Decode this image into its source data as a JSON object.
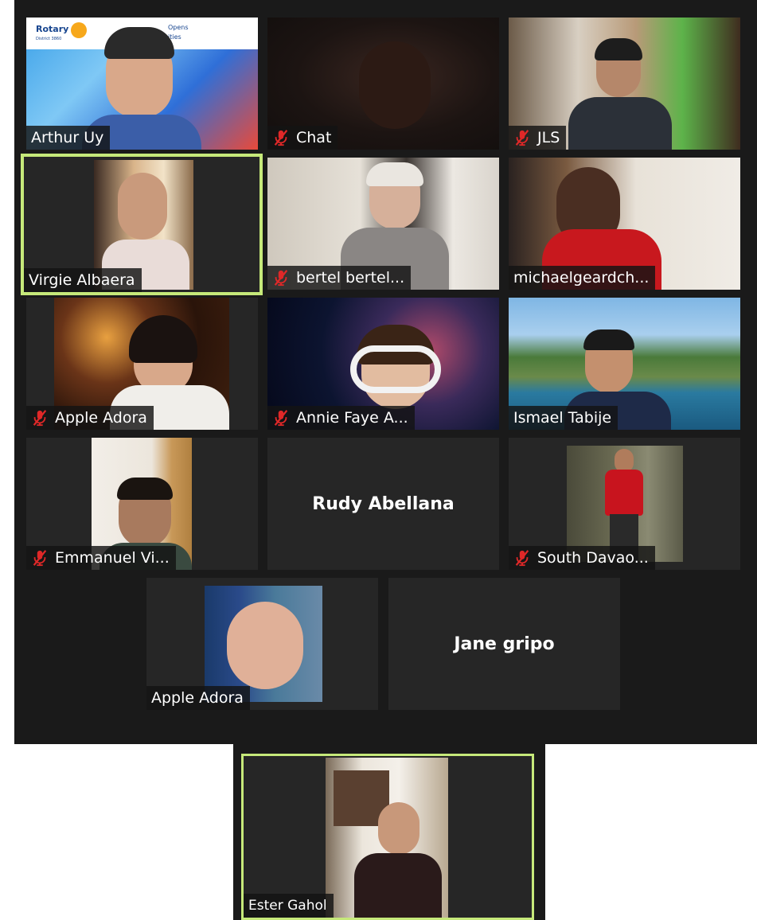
{
  "participants": [
    {
      "name": "Arthur Uy",
      "muted": false
    },
    {
      "name": "Chat",
      "muted": true
    },
    {
      "name": "JLS",
      "muted": true
    },
    {
      "name": "Virgie Albaera",
      "muted": false,
      "speaking": true
    },
    {
      "name": "bertel bertel...",
      "muted": true
    },
    {
      "name": "michaelgeardch...",
      "muted": false
    },
    {
      "name": "Apple Adora",
      "muted": true
    },
    {
      "name": "Annie Faye A...",
      "muted": true
    },
    {
      "name": "Ismael Tabije",
      "muted": false
    },
    {
      "name": "Emmanuel Vi...",
      "muted": true
    },
    {
      "name": "Rudy Abellana",
      "muted": false,
      "video_off": true
    },
    {
      "name": "South Davao...",
      "muted": true
    },
    {
      "name": "Apple Adora",
      "muted": false
    },
    {
      "name": "Jane gripo",
      "muted": false,
      "video_off": true
    }
  ],
  "spotlight": {
    "name": "Ester Gahol",
    "muted": false,
    "speaking": true
  },
  "background_texts": {
    "rotary": "Rotary",
    "district": "District 3860",
    "opens": "Opens",
    "ities": "ities"
  },
  "colors": {
    "active_border": "#c6e97a",
    "mute_red": "#e02828",
    "panel_bg": "#1a1a1a",
    "tile_bg": "#262626"
  }
}
